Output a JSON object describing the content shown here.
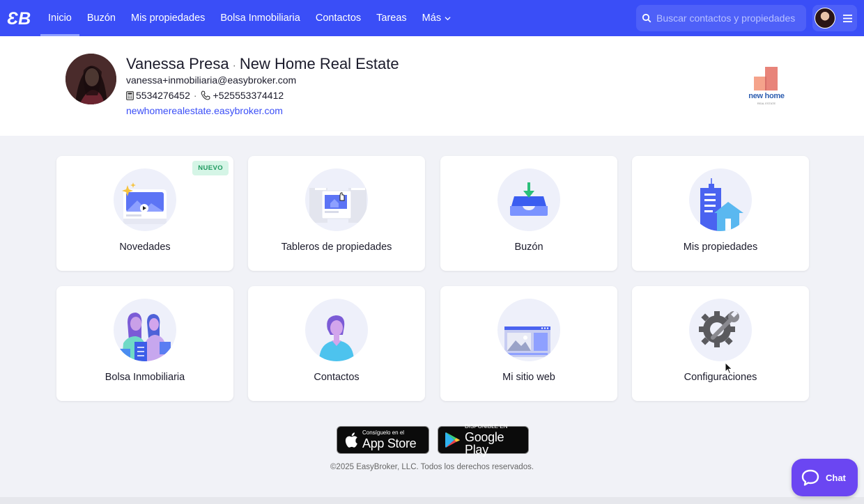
{
  "nav": {
    "logo": "EB",
    "items": [
      {
        "label": "Inicio",
        "active": true
      },
      {
        "label": "Buzón"
      },
      {
        "label": "Mis propiedades"
      },
      {
        "label": "Bolsa Inmobiliaria"
      },
      {
        "label": "Contactos"
      },
      {
        "label": "Tareas"
      },
      {
        "label": "Más"
      }
    ],
    "search_placeholder": "Buscar contactos y propiedades",
    "colors": {
      "primary": "#3a4ef7",
      "search_bg": "#4e60f8"
    }
  },
  "profile": {
    "name": "Vanessa Presa",
    "separator": "·",
    "company": "New Home Real Estate",
    "email": "vanessa+inmobiliaria@easybroker.com",
    "phone_office": "5534276452",
    "phone_mobile": "+525553374412",
    "website": "newhomerealestate.easybroker.com",
    "company_logo": {
      "name": "new home",
      "subtitle": "REAL ESTATE"
    }
  },
  "cards": [
    {
      "label": "Novedades",
      "badge": "NUEVO",
      "icon": "news-icon"
    },
    {
      "label": "Tableros de propiedades",
      "icon": "boards-icon"
    },
    {
      "label": "Buzón",
      "icon": "inbox-icon"
    },
    {
      "label": "Mis propiedades",
      "icon": "properties-icon"
    },
    {
      "label": "Bolsa Inmobiliaria",
      "icon": "market-icon"
    },
    {
      "label": "Contactos",
      "icon": "contact-icon"
    },
    {
      "label": "Mi sitio web",
      "icon": "website-icon"
    },
    {
      "label": "Configuraciones",
      "icon": "settings-icon"
    }
  ],
  "footer": {
    "app_store_small": "Consíguelo en el",
    "app_store_big": "App Store",
    "google_small": "DISPONIBLE EN",
    "google_big": "Google Play",
    "copyright": "©2025 EasyBroker, LLC. Todos los derechos reservados."
  },
  "chat": {
    "label": "Chat",
    "color": "#6b46f2"
  }
}
